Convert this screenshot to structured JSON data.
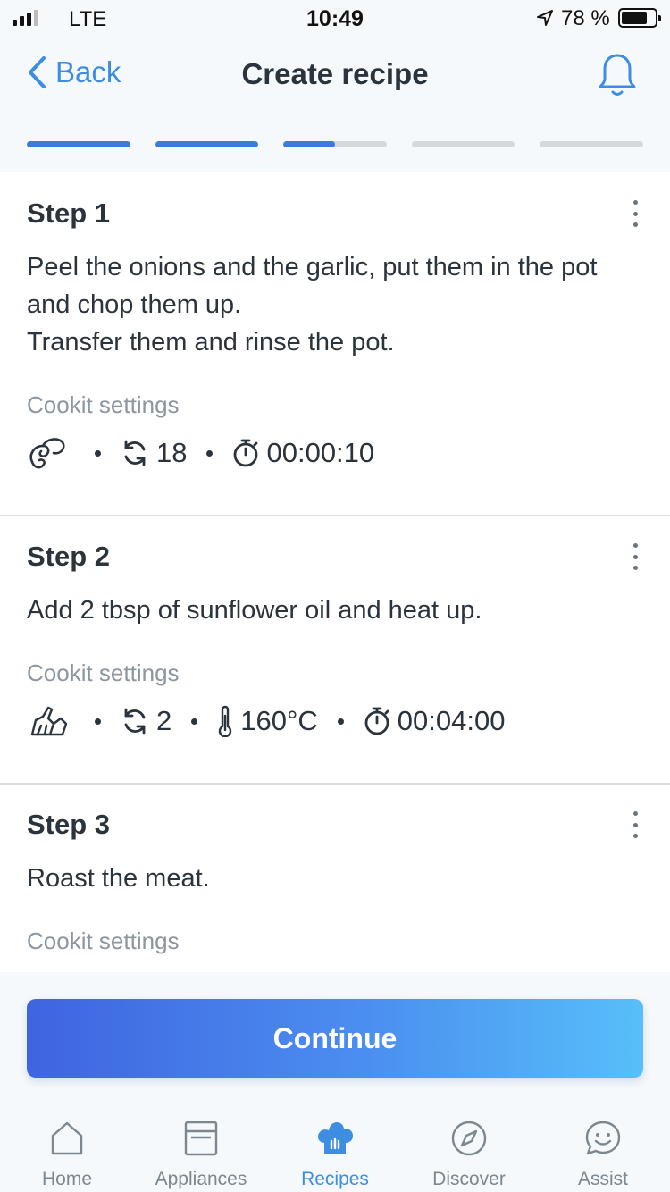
{
  "status_bar": {
    "network": "LTE",
    "time": "10:49",
    "battery_percent": "78 %",
    "battery_level": 0.78,
    "signal_bars": 3
  },
  "nav": {
    "back_label": "Back",
    "title": "Create recipe"
  },
  "progress": {
    "steps_total": 5,
    "fills": [
      1,
      1,
      0.5,
      0,
      0
    ]
  },
  "steps": [
    {
      "title": "Step 1",
      "text": "Peel the onions and the garlic, put them in the pot and chop them up.\nTransfer them and rinse the pot.",
      "settings_label": "Cookit settings",
      "tool_icon": "chopping-blade-icon",
      "speed": "18",
      "timer": "00:00:10"
    },
    {
      "title": "Step 2",
      "text": "Add 2 tbsp of sunflower oil and heat up.",
      "settings_label": "Cookit settings",
      "tool_icon": "stirrer-icon",
      "speed": "2",
      "temperature": "160°C",
      "timer": "00:04:00"
    },
    {
      "title": "Step 3",
      "text": "Roast the meat.",
      "settings_label": "Cookit settings"
    }
  ],
  "cta": {
    "continue_label": "Continue"
  },
  "tabbar": {
    "items": [
      {
        "label": "Home",
        "icon": "home-icon"
      },
      {
        "label": "Appliances",
        "icon": "appliance-icon"
      },
      {
        "label": "Recipes",
        "icon": "chef-hat-icon",
        "active": true
      },
      {
        "label": "Discover",
        "icon": "compass-icon"
      },
      {
        "label": "Assist",
        "icon": "chat-smile-icon"
      }
    ]
  },
  "colors": {
    "accent": "#3d8de3",
    "progress_fill": "#3b7bdb",
    "progress_track": "#d5d9dd",
    "text": "#2b343c",
    "muted": "#8b96a0",
    "cta_gradient_start": "#3f64e0",
    "cta_gradient_end": "#57bff9"
  }
}
